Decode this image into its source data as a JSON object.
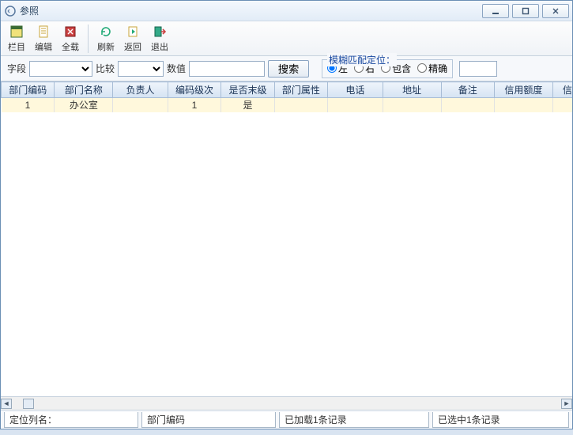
{
  "window": {
    "title": "参照"
  },
  "toolbar": {
    "items": [
      {
        "label": "栏目",
        "name": "columns"
      },
      {
        "label": "编辑",
        "name": "edit"
      },
      {
        "label": "全载",
        "name": "loadall"
      }
    ],
    "items2": [
      {
        "label": "刷新",
        "name": "refresh"
      },
      {
        "label": "返回",
        "name": "back"
      },
      {
        "label": "退出",
        "name": "exit"
      }
    ]
  },
  "search": {
    "fieldLabel": "字段",
    "compareLabel": "比较",
    "valueLabel": "数值",
    "buttonLabel": "搜索",
    "placeholder": ""
  },
  "match": {
    "legend": "模糊匹配定位：",
    "options": [
      "左",
      "右",
      "包含",
      "精确"
    ],
    "selected": "左"
  },
  "table": {
    "columns": [
      "部门编码",
      "部门名称",
      "负责人",
      "编码级次",
      "是否末级",
      "部门属性",
      "电话",
      "地址",
      "备注",
      "信用额度",
      "信用等"
    ],
    "rows": [
      {
        "cells": [
          "1",
          "办公室",
          "",
          "1",
          "是",
          "",
          "",
          "",
          "",
          "",
          ""
        ]
      }
    ]
  },
  "status": {
    "label1": "定位列名：",
    "value1": "部门编码",
    "loaded": "已加载1条记录",
    "selected": "已选中1条记录"
  }
}
